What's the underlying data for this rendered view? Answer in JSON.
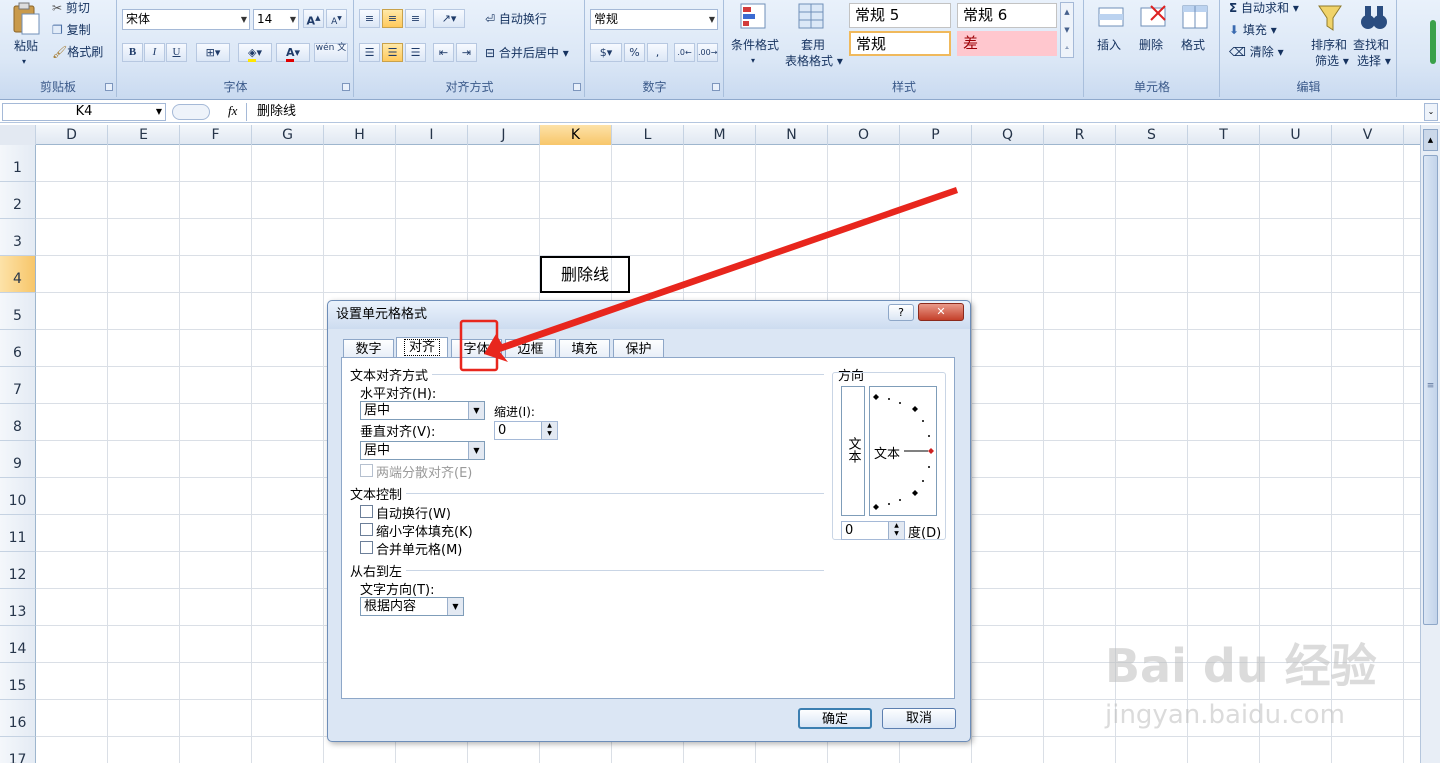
{
  "ribbon": {
    "clipboard": {
      "paste": "粘贴",
      "cut": "剪切",
      "copy": "复制",
      "format_painter": "格式刷",
      "label": "剪贴板"
    },
    "font": {
      "name": "宋体",
      "size": "14",
      "bold": "B",
      "italic": "I",
      "underline": "U",
      "grow": "A",
      "shrink": "A",
      "font_color": "A",
      "phonetic": "wén 文",
      "label": "字体"
    },
    "alignment": {
      "wrap_text": "自动换行",
      "merge_center": "合并后居中",
      "label": "对齐方式"
    },
    "number": {
      "format": "常规",
      "percent": "%",
      "comma": ",",
      "label": "数字"
    },
    "styles": {
      "conditional": "条件格式",
      "table_format_1": "套用",
      "table_format_2": "表格格式",
      "cell1": "常规 5",
      "cell2": "常规 6",
      "cell3": "常规",
      "cell4": "差",
      "label": "样式"
    },
    "cells": {
      "insert": "插入",
      "delete": "删除",
      "format": "格式",
      "label": "单元格"
    },
    "editing": {
      "autosum": "自动求和",
      "fill": "填充",
      "clear": "清除",
      "sort_1": "排序和",
      "sort_2": "筛选",
      "find_1": "查找和",
      "find_2": "选择",
      "label": "编辑"
    }
  },
  "formula_bar": {
    "name_box": "K4",
    "fx": "fx",
    "content": "删除线"
  },
  "columns": [
    "D",
    "E",
    "F",
    "G",
    "H",
    "I",
    "J",
    "K",
    "L",
    "M",
    "N",
    "O",
    "P",
    "Q",
    "R",
    "S",
    "T",
    "U",
    "V"
  ],
  "rows": [
    "1",
    "2",
    "3",
    "4",
    "5",
    "6",
    "7",
    "8",
    "9",
    "10",
    "11",
    "12",
    "13",
    "14",
    "15",
    "16",
    "17"
  ],
  "cell_k4": "删除线",
  "dialog": {
    "title": "设置单元格格式",
    "help": "?",
    "close": "✕",
    "tabs": [
      "数字",
      "对齐",
      "字体",
      "边框",
      "填充",
      "保护"
    ],
    "text_alignment": "文本对齐方式",
    "horizontal": "水平对齐(H):",
    "horizontal_value": "居中",
    "indent": "缩进(I):",
    "indent_value": "0",
    "vertical": "垂直对齐(V):",
    "vertical_value": "居中",
    "justify_distributed": "两端分散对齐(E)",
    "text_control": "文本控制",
    "wrap": "自动换行(W)",
    "shrink": "缩小字体填充(K)",
    "merge": "合并单元格(M)",
    "rtl": "从右到左",
    "text_direction": "文字方向(T):",
    "text_direction_value": "根据内容",
    "orientation": "方向",
    "orient_vertical": "文本",
    "orient_text": "文本",
    "degrees_value": "0",
    "degrees": "度(D)",
    "ok": "确定",
    "cancel": "取消"
  },
  "annotation_color": "#e8261d",
  "watermark": {
    "brand": "Bai du 经验",
    "url": "jingyan.baidu.com"
  }
}
